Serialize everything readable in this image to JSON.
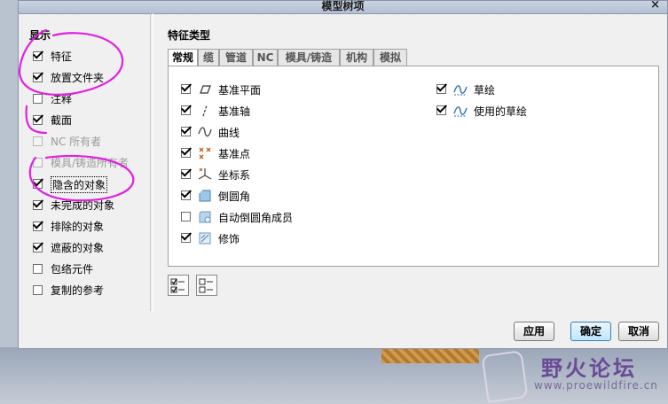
{
  "dialog": {
    "title": "模型树项",
    "close_glyph": "×"
  },
  "display": {
    "title": "显示",
    "options": [
      {
        "label": "特征",
        "checked": true,
        "enabled": true
      },
      {
        "label": "放置文件夹",
        "checked": true,
        "enabled": true
      },
      {
        "label": "注释",
        "checked": false,
        "enabled": true
      },
      {
        "label": "截面",
        "checked": true,
        "enabled": true
      },
      {
        "label": "NC 所有者",
        "checked": false,
        "enabled": false
      },
      {
        "label": "模具/铸造所有者",
        "checked": false,
        "enabled": false
      },
      {
        "label": "隐含的对象",
        "checked": true,
        "enabled": true
      },
      {
        "label": "未完成的对象",
        "checked": true,
        "enabled": true
      },
      {
        "label": "排除的对象",
        "checked": true,
        "enabled": true
      },
      {
        "label": "遮蔽的对象",
        "checked": true,
        "enabled": true
      },
      {
        "label": "包络元件",
        "checked": false,
        "enabled": true
      },
      {
        "label": "复制的参考",
        "checked": false,
        "enabled": true
      }
    ]
  },
  "feature_types": {
    "title": "特征类型",
    "tabs": [
      "常规",
      "缆",
      "管道",
      "NC",
      "模具/铸造",
      "机构",
      "模拟"
    ],
    "active_tab": "常规",
    "left_items": [
      {
        "label": "基准平面",
        "checked": true,
        "icon": "datum-plane-icon"
      },
      {
        "label": "基准轴",
        "checked": true,
        "icon": "datum-axis-icon"
      },
      {
        "label": "曲线",
        "checked": true,
        "icon": "curve-icon"
      },
      {
        "label": "基准点",
        "checked": true,
        "icon": "datum-point-icon"
      },
      {
        "label": "坐标系",
        "checked": true,
        "icon": "coordinate-system-icon"
      },
      {
        "label": "倒圆角",
        "checked": true,
        "icon": "round-icon"
      },
      {
        "label": "自动倒圆角成员",
        "checked": false,
        "icon": "auto-round-member-icon"
      },
      {
        "label": "修饰",
        "checked": true,
        "icon": "cosmetic-icon"
      }
    ],
    "right_items": [
      {
        "label": "草绘",
        "checked": true,
        "icon": "sketch-icon"
      },
      {
        "label": "使用的草绘",
        "checked": true,
        "icon": "used-sketch-icon"
      }
    ],
    "select_all_icon": "select-all-icon",
    "clear_all_icon": "clear-all-icon"
  },
  "buttons": {
    "apply": "应用",
    "ok": "确定",
    "cancel": "取消"
  },
  "watermark": {
    "title": "野火论坛",
    "url": "www.proewildfire.cn"
  },
  "colors": {
    "annotation": "#e020e0",
    "primary_button": "#bee6fd",
    "titlebar": "#c3cddc"
  }
}
